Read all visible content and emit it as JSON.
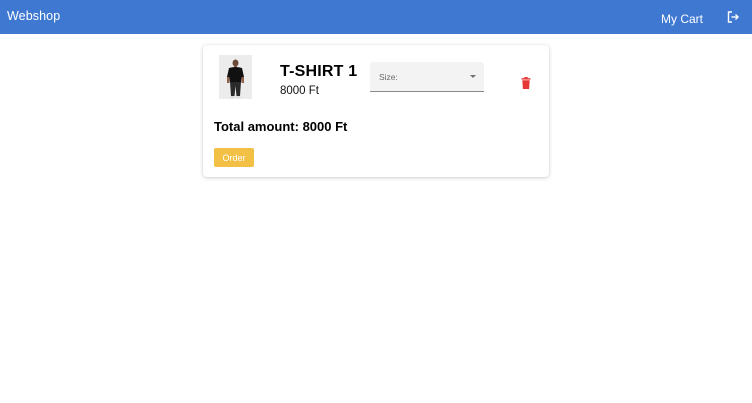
{
  "header": {
    "brand": "Webshop",
    "cart_label": "My Cart",
    "logout_icon": "logout-icon",
    "background_color": "#3f78d1"
  },
  "cart": {
    "items": [
      {
        "name": "T-SHIRT 1",
        "price": "8000 Ft",
        "size_label": "Size:",
        "delete_icon": "trash-icon"
      }
    ],
    "total": "Total amount: 8000 Ft",
    "order_label": "Order",
    "order_color": "#f2c044",
    "delete_color": "#e53935"
  }
}
